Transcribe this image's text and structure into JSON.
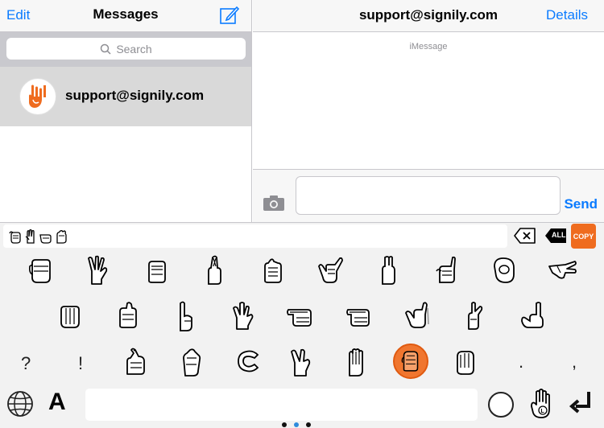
{
  "left_header": {
    "edit": "Edit",
    "title": "Messages"
  },
  "search": {
    "placeholder": "Search"
  },
  "conversation": {
    "name": "support@signily.com"
  },
  "right_header": {
    "title": "support@signily.com",
    "details": "Details"
  },
  "thread": {
    "service_label": "iMessage"
  },
  "composer": {
    "send": "Send"
  },
  "keyboard": {
    "copy_label": "COPY",
    "delete_all_label": "ALL",
    "typed_signs": [
      "hand-sign-a",
      "hand-sign-b",
      "hand-sign-g",
      "hand-sign-e"
    ],
    "punctuation": {
      "question": "?",
      "exclaim": "!",
      "period": ".",
      "comma": ","
    },
    "letter_key": "A",
    "active_key": "hand-sign-s",
    "page_count": 3,
    "current_page": 2,
    "accent_color": "#f0762f"
  },
  "colors": {
    "link": "#0a7bff",
    "selected_row": "#d9d9d9",
    "copy_button": "#ef6c1f"
  }
}
